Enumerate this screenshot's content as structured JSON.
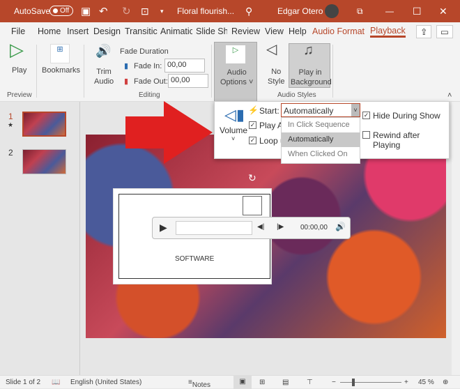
{
  "titlebar": {
    "autosave": "AutoSave",
    "toggle": "Off",
    "doc_title": "Floral flourish...",
    "user": "Edgar Otero"
  },
  "tabs": [
    "File",
    "Home",
    "Insert",
    "Design",
    "Transitic",
    "Animatic",
    "Slide Sh",
    "Review",
    "View",
    "Help",
    "Audio Format",
    "Playback"
  ],
  "ribbon": {
    "play": "Play",
    "bookmarks": "Bookmarks",
    "trim1": "Trim",
    "trim2": "Audio",
    "fade_duration": "Fade Duration",
    "fade_in_label": "Fade In:",
    "fade_in": "00,00",
    "fade_out_label": "Fade Out:",
    "fade_out": "00,00",
    "audio_options1": "Audio",
    "audio_options2": "Options",
    "no_style1": "No",
    "no_style2": "Style",
    "play_bg1": "Play in",
    "play_bg2": "Background",
    "groups": {
      "preview": "Preview",
      "editing": "Editing",
      "audio_styles": "Audio Styles"
    }
  },
  "popup": {
    "volume": "Volume",
    "start_label": "Start:",
    "start_value": "Automatically",
    "play_across": "Play A",
    "loop": "Loop u",
    "hide": "Hide During Show",
    "rewind": "Rewind after Playing",
    "options": [
      "In Click Sequence",
      "Automatically",
      "When Clicked On"
    ],
    "hide_checked": true,
    "rewind_checked": false
  },
  "slides": {
    "numbers": [
      "1",
      "2"
    ]
  },
  "slide": {
    "text": "SOFTWARE",
    "time": "00:00,00"
  },
  "status": {
    "slide": "Slide 1 of 2",
    "language": "English (United States)",
    "notes": "Notes",
    "zoom": "45 %"
  },
  "colors": {
    "accent": "#b7472a",
    "arrow": "#e02020"
  }
}
